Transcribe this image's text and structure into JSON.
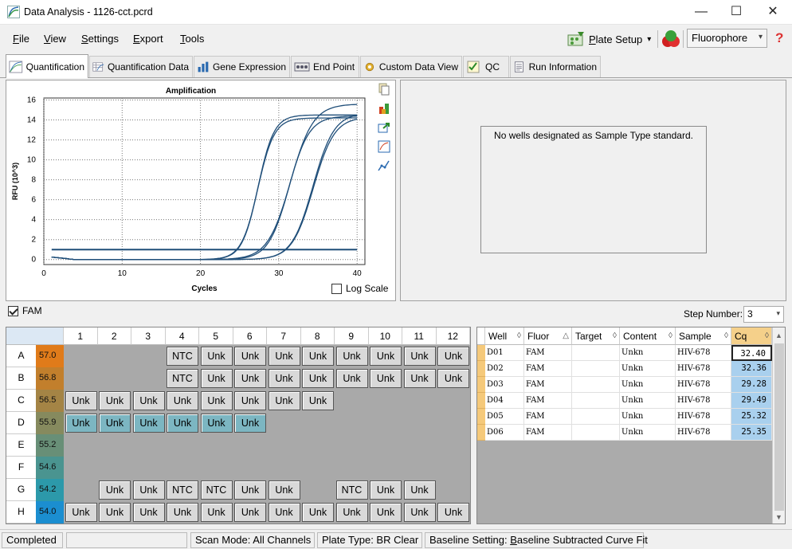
{
  "window": {
    "title": "Data Analysis - 1126-cct.pcrd",
    "minimize": "—",
    "maximize": "☐",
    "close": "✕"
  },
  "menu": [
    {
      "label": "File",
      "key": "F",
      "rest": "ile"
    },
    {
      "label": "View",
      "key": "V",
      "rest": "iew"
    },
    {
      "label": "Settings",
      "key": "S",
      "rest": "ettings"
    },
    {
      "label": "Export",
      "key": "E",
      "rest": "xport"
    },
    {
      "label": "Tools",
      "key": "T",
      "rest": "ools"
    }
  ],
  "toolbar": {
    "plate_setup_key": "P",
    "plate_setup_rest": "late Setup",
    "plate_setup_arrow": "▾",
    "fluorophore": "Fluorophore",
    "help": "?"
  },
  "tabs": [
    "Quantification",
    "Quantification Data",
    "Gene Expression",
    "End Point",
    "Custom Data View",
    "QC",
    "Run Information"
  ],
  "chart_data": {
    "type": "line",
    "title": "Amplification",
    "xlabel": "Cycles",
    "ylabel": "RFU (10^3)",
    "xlim": [
      0,
      41
    ],
    "ylim": [
      -0.5,
      16.2
    ],
    "xticks": [
      0,
      10,
      20,
      30,
      40
    ],
    "yticks": [
      0,
      2,
      4,
      6,
      8,
      10,
      12,
      14,
      16
    ],
    "threshold": 1.0,
    "grid": true,
    "color": "#1f4e79",
    "series": [
      {
        "cq": 25.32,
        "plateau": 14.2,
        "slope": 1.05
      },
      {
        "cq": 25.35,
        "plateau": 14.5,
        "slope": 1.02
      },
      {
        "cq": 29.28,
        "plateau": 14.4,
        "slope": 1.3
      },
      {
        "cq": 29.49,
        "plateau": 15.6,
        "slope": 1.45
      },
      {
        "cq": 32.36,
        "plateau": 14.7,
        "slope": 1.35
      },
      {
        "cq": 32.4,
        "plateau": 14.3,
        "slope": 1.35
      }
    ]
  },
  "chart": {
    "log_scale_label": "Log Scale"
  },
  "standard_panel": {
    "message": "No wells designated as Sample Type standard."
  },
  "fluor_filter": {
    "label": "FAM",
    "step_label": "Step Number:",
    "step_value": "3",
    "arrow": "▾"
  },
  "plate": {
    "columns": [
      "1",
      "2",
      "3",
      "4",
      "5",
      "6",
      "7",
      "8",
      "9",
      "10",
      "11",
      "12"
    ],
    "rows": [
      {
        "label": "A",
        "temp": "57.0",
        "color": "#e07b1a",
        "cells": [
          "",
          "",
          "",
          "NTC",
          "Unk",
          "Unk",
          "Unk",
          "Unk",
          "Unk",
          "Unk",
          "Unk",
          "Unk"
        ]
      },
      {
        "label": "B",
        "temp": "56.8",
        "color": "#c27f2c",
        "cells": [
          "",
          "",
          "",
          "NTC",
          "Unk",
          "Unk",
          "Unk",
          "Unk",
          "Unk",
          "Unk",
          "Unk",
          "Unk"
        ]
      },
      {
        "label": "C",
        "temp": "56.5",
        "color": "#a48445",
        "cells": [
          "Unk",
          "Unk",
          "Unk",
          "Unk",
          "Unk",
          "Unk",
          "Unk",
          "Unk",
          "",
          "",
          "",
          ""
        ]
      },
      {
        "label": "D",
        "temp": "55.9",
        "color": "#868a5e",
        "cells": [
          "Unk",
          "Unk",
          "Unk",
          "Unk",
          "Unk",
          "Unk",
          "",
          "",
          "",
          "",
          "",
          ""
        ]
      },
      {
        "label": "E",
        "temp": "55.2",
        "color": "#688f77",
        "cells": [
          "",
          "",
          "",
          "",
          "",
          "",
          "",
          "",
          "",
          "",
          "",
          ""
        ]
      },
      {
        "label": "F",
        "temp": "54.6",
        "color": "#4a9490",
        "cells": [
          "",
          "",
          "",
          "",
          "",
          "",
          "",
          "",
          "",
          "",
          "",
          ""
        ]
      },
      {
        "label": "G",
        "temp": "54.2",
        "color": "#2c99aa",
        "cells": [
          "",
          "Unk",
          "Unk",
          "NTC",
          "NTC",
          "Unk",
          "Unk",
          "",
          "NTC",
          "Unk",
          "Unk",
          ""
        ]
      },
      {
        "label": "H",
        "temp": "54.0",
        "color": "#1b8ed0",
        "cells": [
          "Unk",
          "Unk",
          "Unk",
          "Unk",
          "Unk",
          "Unk",
          "Unk",
          "Unk",
          "Unk",
          "Unk",
          "Unk",
          "Unk"
        ]
      }
    ],
    "selected_row": "D"
  },
  "results": {
    "headers": [
      "Well",
      "Fluor",
      "Target",
      "Content",
      "Sample",
      "Cq"
    ],
    "sort_glyphs": [
      "◊",
      "△",
      "◊",
      "◊",
      "◊",
      "◊"
    ],
    "rows": [
      {
        "well": "D01",
        "fluor": "FAM",
        "target": "",
        "content": "Unkn",
        "sample": "HIV-678",
        "cq": "32.40"
      },
      {
        "well": "D02",
        "fluor": "FAM",
        "target": "",
        "content": "Unkn",
        "sample": "HIV-678",
        "cq": "32.36"
      },
      {
        "well": "D03",
        "fluor": "FAM",
        "target": "",
        "content": "Unkn",
        "sample": "HIV-678",
        "cq": "29.28"
      },
      {
        "well": "D04",
        "fluor": "FAM",
        "target": "",
        "content": "Unkn",
        "sample": "HIV-678",
        "cq": "29.49"
      },
      {
        "well": "D05",
        "fluor": "FAM",
        "target": "",
        "content": "Unkn",
        "sample": "HIV-678",
        "cq": "25.32"
      },
      {
        "well": "D06",
        "fluor": "FAM",
        "target": "",
        "content": "Unkn",
        "sample": "HIV-678",
        "cq": "25.35"
      }
    ],
    "scroll_up": "▲",
    "scroll_down": "▼"
  },
  "status": {
    "state": "Completed",
    "scan_mode": "Scan Mode: All Channels",
    "plate_type": "Plate Type: BR Clear",
    "baseline_prefix": "Baseline Setting: ",
    "baseline_key": "B",
    "baseline_rest": "aseline Subtracted Curve Fit"
  }
}
